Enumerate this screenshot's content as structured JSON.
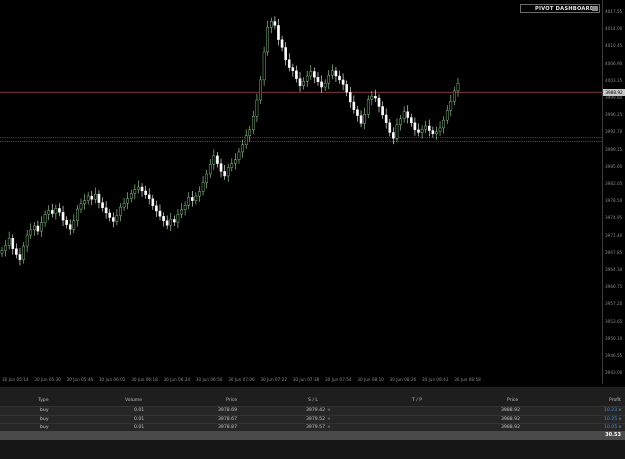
{
  "chart_data": {
    "type": "candlestick",
    "bullish_color": "#9fe09f",
    "bearish_color": "#ffffff",
    "ylim": [
      3961.5,
      4018.5
    ],
    "closes": [
      3980.2,
      3981.0,
      3982.1,
      3980.5,
      3979.6,
      3978.8,
      3980.9,
      3982.6,
      3983.4,
      3984.0,
      3983.2,
      3984.5,
      3985.8,
      3986.4,
      3985.9,
      3986.7,
      3986.1,
      3984.9,
      3984.2,
      3983.5,
      3984.8,
      3986.6,
      3987.4,
      3987.9,
      3988.6,
      3988.1,
      3988.9,
      3987.6,
      3986.8,
      3986.0,
      3985.3,
      3984.7,
      3985.6,
      3986.9,
      3987.5,
      3988.2,
      3989.0,
      3989.6,
      3990.0,
      3989.4,
      3988.8,
      3988.2,
      3987.1,
      3986.3,
      3985.5,
      3984.8,
      3984.1,
      3985.0,
      3984.6,
      3985.8,
      3986.5,
      3987.2,
      3988.4,
      3987.9,
      3988.6,
      3989.3,
      3990.7,
      3992.0,
      3993.5,
      3994.8,
      3993.6,
      3992.4,
      3991.7,
      3993.0,
      3993.6,
      3994.2,
      3995.4,
      3996.5,
      3997.9,
      3998.8,
      4000.9,
      4003.4,
      4006.5,
      4010.8,
      4014.6,
      4015.5,
      4014.9,
      4012.7,
      4011.5,
      4009.6,
      4008.4,
      4007.9,
      4006.7,
      4005.6,
      4006.3,
      4007.1,
      4007.8,
      4006.9,
      4006.2,
      4005.4,
      4006.0,
      4007.2,
      4007.9,
      4007.1,
      4006.5,
      4005.8,
      4004.6,
      4003.1,
      4001.9,
      4001.0,
      3999.8,
      4001.2,
      4003.5,
      4004.0,
      4003.7,
      4002.4,
      4001.1,
      3999.9,
      3998.4,
      3997.5,
      3999.6,
      4000.5,
      4001.6,
      4000.7,
      3999.9,
      3998.8,
      3998.4,
      3998.9,
      3999.4,
      3998.7,
      3998.2,
      3998.5,
      3999.1,
      4000.3,
      4001.8,
      4003.2,
      4004.8,
      4006.0
    ],
    "horizontal_levels": [
      {
        "name": "current-price-line",
        "value": 4004.6,
        "color": "#b04a4a",
        "style": "solid"
      },
      {
        "name": "pivot-line",
        "value": 3997.6,
        "color": "#8a3d3d",
        "style": "dotted"
      },
      {
        "name": "pivot-line-2",
        "value": 3997.0,
        "color": "#8a3d3d",
        "style": "dotted"
      }
    ],
    "price_ticks": [
      "4017.55",
      "4014.00",
      "4010.45",
      "4006.90",
      "4003.35",
      "3999.80",
      "3996.25",
      "3992.70",
      "3989.15",
      "3985.60",
      "3982.05",
      "3978.50",
      "3974.95",
      "3971.40",
      "3967.85",
      "3964.30",
      "3960.75",
      "3957.20",
      "3953.65",
      "3950.10",
      "3946.55",
      "3943.00"
    ],
    "current_price_label": "3988.92",
    "time_ticks": [
      "30 Jun 05:14",
      "30 Jun 05:30",
      "30 Jun 05:46",
      "30 Jun 06:02",
      "30 Jun 06:18",
      "30 Jun 06:34",
      "30 Jun 06:50",
      "30 Jun 07:06",
      "30 Jun 07:22",
      "30 Jun 07:38",
      "30 Jun 07:54",
      "30 Jun 08:10",
      "30 Jun 08:26",
      "30 Jun 08:42",
      "30 Jun 08:58"
    ]
  },
  "dashboard": {
    "label": "PIVOT DASHBOARD"
  },
  "positions": {
    "headers": {
      "type": "Type",
      "volume": "Volume",
      "price": "Price",
      "sl": "S / L",
      "tp": "T / P",
      "cur_price": "Price",
      "profit": "Profit"
    },
    "rows": [
      {
        "type": "buy",
        "volume": "0.01",
        "price": "3978.69",
        "sl": "3979.42",
        "tp": "",
        "cur_price": "3988.92",
        "profit": "10.23"
      },
      {
        "type": "buy",
        "volume": "0.01",
        "price": "3978.67",
        "sl": "3979.52",
        "tp": "",
        "cur_price": "3988.92",
        "profit": "10.25"
      },
      {
        "type": "buy",
        "volume": "0.01",
        "price": "3978.87",
        "sl": "3979.57",
        "tp": "",
        "cur_price": "3988.92",
        "profit": "10.05"
      }
    ],
    "close_glyph": "×",
    "total_profit": "30.53"
  }
}
